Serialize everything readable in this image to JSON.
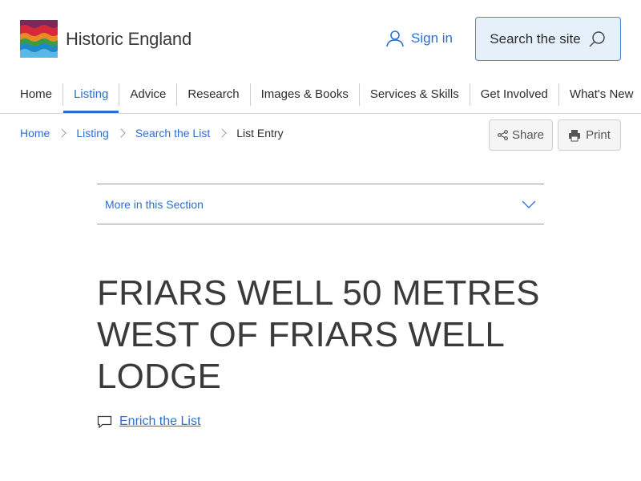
{
  "header": {
    "logo_text": "Historic England",
    "signin_label": "Sign in",
    "search_label": "Search the site"
  },
  "nav": {
    "items": [
      {
        "label": "Home"
      },
      {
        "label": "Listing"
      },
      {
        "label": "Advice"
      },
      {
        "label": "Research"
      },
      {
        "label": "Images & Books"
      },
      {
        "label": "Services & Skills"
      },
      {
        "label": "Get Involved"
      },
      {
        "label": "What's New"
      }
    ],
    "active": "Listing"
  },
  "breadcrumb": {
    "items": [
      {
        "label": "Home"
      },
      {
        "label": "Listing"
      },
      {
        "label": "Search the List"
      },
      {
        "label": "List Entry"
      }
    ]
  },
  "actions": {
    "share_label": "Share",
    "print_label": "Print"
  },
  "section": {
    "more_label": "More in this Section"
  },
  "main": {
    "title": "FRIARS WELL 50 METRES WEST OF FRIARS WELL LODGE",
    "enrich_label": "Enrich the List"
  },
  "colors": {
    "accent": "#2a6fd0",
    "search_bg": "#e6f0fb",
    "text": "#2c2c2c"
  },
  "icons": {
    "signin": "user-icon",
    "search": "search-icon",
    "share": "share-icon",
    "print": "printer-icon",
    "more": "chevron-down-icon",
    "enrich": "comment-icon"
  }
}
